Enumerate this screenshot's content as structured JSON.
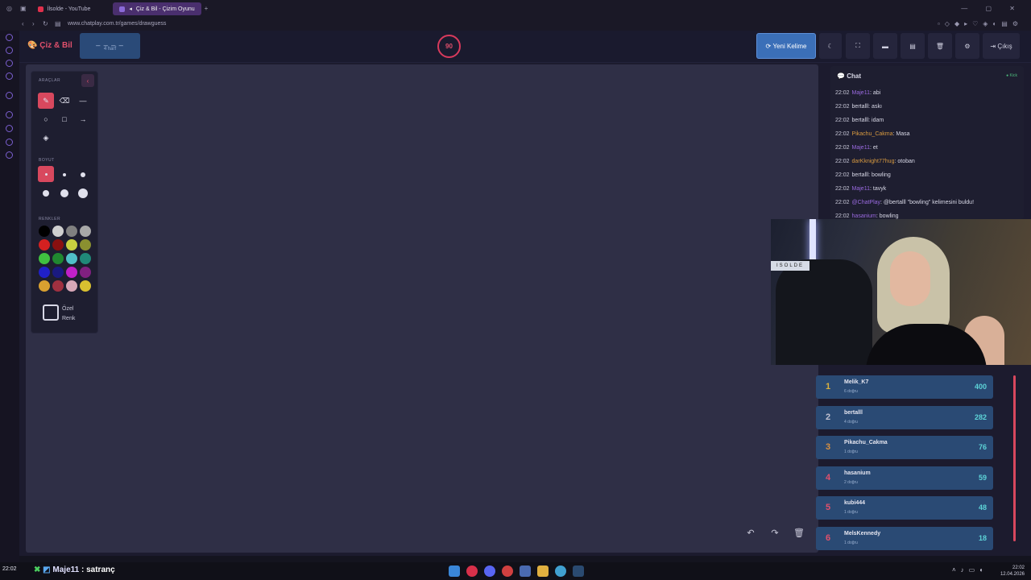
{
  "browser": {
    "tabs": [
      {
        "label": "İlsolde - YouTube",
        "color": "#e0304c"
      },
      {
        "label": "Çiz & Bil - Çizim Oyunu",
        "color": "#8a6ad8"
      }
    ],
    "url": "www.chatplay.com.tr/games/drawguess",
    "new_tab": "+"
  },
  "header": {
    "logo": "Çiz & Bil",
    "word_dashes": "_ _ _ _",
    "word_hint": "4 harf",
    "timer": "90",
    "new_word_label": "Yeni Kelime",
    "logout_label": "Çıkış"
  },
  "tools": {
    "tools_title": "ARAÇLAR",
    "size_title": "BOYUT",
    "colors_title": "RENKLER",
    "custom_color_label": "Özel Renk",
    "colors": [
      "#000000",
      "#cfcfcf",
      "#808080",
      "#a8a8a8",
      "#d42020",
      "#8a1010",
      "#c8d040",
      "#8a9030",
      "#40c040",
      "#208830",
      "#50c0c8",
      "#208878",
      "#2020c8",
      "#1a1a80",
      "#c020c8",
      "#802080",
      "#d8a030",
      "#a03040",
      "#d8a8b8",
      "#d8c030"
    ]
  },
  "chat": {
    "title": "Chat",
    "kick_label": "Kick",
    "messages": [
      {
        "time": "22:02",
        "user": "Maje11",
        "color": "#9a6ae0",
        "text": ": abi"
      },
      {
        "time": "22:02",
        "user": "bertalll",
        "color": "#d8d8e6",
        "text": ": askı"
      },
      {
        "time": "22:02",
        "user": "bertalll",
        "color": "#d8d8e6",
        "text": ": idam"
      },
      {
        "time": "22:02",
        "user": "Pikachu_Cakma",
        "color": "#d89a40",
        "text": ": Masa"
      },
      {
        "time": "22:02",
        "user": "Maje11",
        "color": "#9a6ae0",
        "text": ": et"
      },
      {
        "time": "22:02",
        "user": "darKknight77hug",
        "color": "#d89a40",
        "text": ": otoban"
      },
      {
        "time": "22:02",
        "user": "bertalll",
        "color": "#d8d8e6",
        "text": ": bowling"
      },
      {
        "time": "22:02",
        "user": "Maje11",
        "color": "#9a6ae0",
        "text": ": tavyk"
      },
      {
        "time": "22:02",
        "user": "@ChatPlay",
        "color": "#9a6ae0",
        "text": ": @bertalll \"bowling\" kelimesini buldu!"
      },
      {
        "time": "22:02",
        "user": "hasanium",
        "color": "#9a6ae0",
        "text": ": bowling"
      }
    ]
  },
  "webcam": {
    "sign": "ISOLDE"
  },
  "leaderboard": [
    {
      "rank": "1",
      "name": "Melik_K7",
      "sub": "6 doğru",
      "score": "400",
      "color": "#d8b040"
    },
    {
      "rank": "2",
      "name": "bertalll",
      "sub": "4 doğru",
      "score": "282",
      "color": "#c0c0d0"
    },
    {
      "rank": "3",
      "name": "Pikachu_Cakma",
      "sub": "1 doğru",
      "score": "76",
      "color": "#d89040"
    },
    {
      "rank": "4",
      "name": "hasanium",
      "sub": "2 doğru",
      "score": "59",
      "color": "#e0506c"
    },
    {
      "rank": "5",
      "name": "kubi444",
      "sub": "1 doğru",
      "score": "48",
      "color": "#e0506c"
    },
    {
      "rank": "6",
      "name": "MelsKennedy",
      "sub": "1 doğru",
      "score": "18",
      "color": "#e0506c"
    }
  ],
  "taskbar": {
    "time_left": "22:02",
    "chat_user": "Maje11",
    "chat_text": " : satranç",
    "clock_time": "22:02",
    "clock_date": "12.04.2026"
  }
}
